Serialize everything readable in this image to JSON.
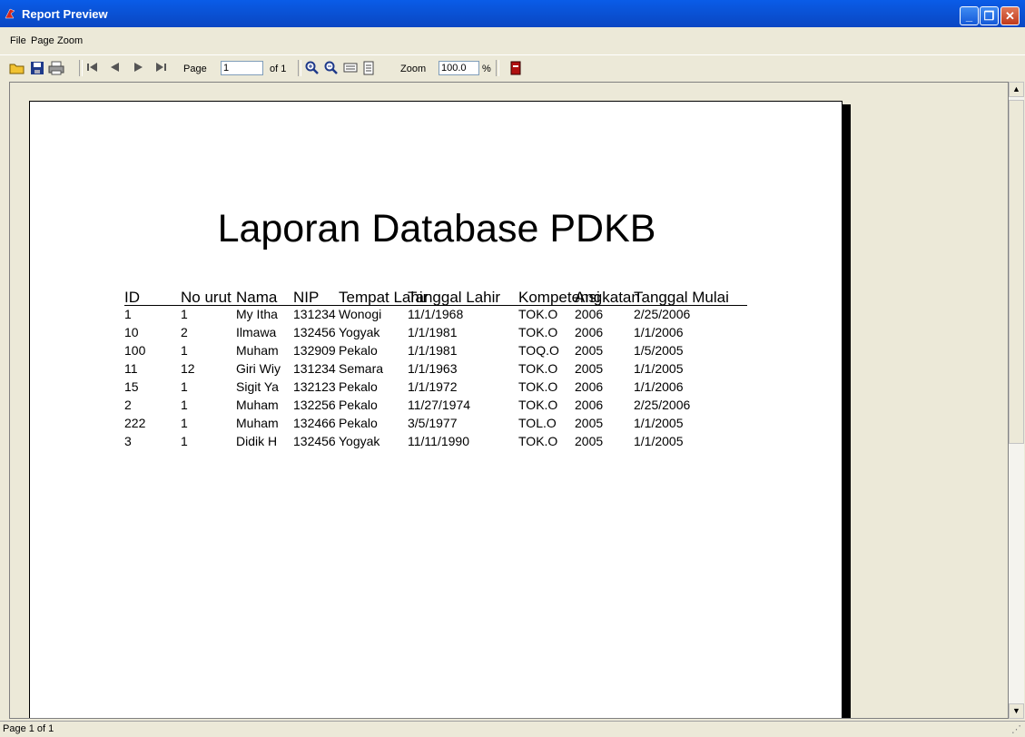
{
  "window": {
    "title": "Report Preview"
  },
  "menu": [
    "File",
    "Page",
    "Zoom"
  ],
  "toolbar": {
    "page_label": "Page",
    "page_value": "1",
    "of_label": "of 1",
    "zoom_label": "Zoom",
    "zoom_value": "100.0",
    "percent": "%"
  },
  "report": {
    "title": "Laporan Database PDKB",
    "columns": [
      "ID",
      "No urut",
      "Nama",
      "NIP",
      "Tempat Lahir",
      "Tanggal Lahir",
      "Kompetensi",
      "Angkatan",
      "Tanggal Mulai"
    ],
    "rows": [
      [
        "1",
        "1",
        "My Itha",
        "131234",
        "Wonogi",
        "11/1/1968",
        "TOK.O",
        "2006",
        "2/25/2006"
      ],
      [
        "10",
        "2",
        "Ilmawa",
        "132456",
        "Yogyak",
        "1/1/1981",
        "TOK.O",
        "2006",
        "1/1/2006"
      ],
      [
        "100",
        "1",
        "Muham",
        "132909",
        "Pekalo",
        "1/1/1981",
        "TOQ.O",
        "2005",
        "1/5/2005"
      ],
      [
        "11",
        "12",
        "Giri Wiy",
        "131234",
        "Semara",
        "1/1/1963",
        "TOK.O",
        "2005",
        "1/1/2005"
      ],
      [
        "15",
        "1",
        "Sigit Ya",
        "132123",
        "Pekalo",
        "1/1/1972",
        "TOK.O",
        "2006",
        "1/1/2006"
      ],
      [
        "2",
        "1",
        "Muham",
        "132256",
        "Pekalo",
        "11/27/1974",
        "TOK.O",
        "2006",
        "2/25/2006"
      ],
      [
        "222",
        "1",
        "Muham",
        "132466",
        "Pekalo",
        "3/5/1977",
        "TOL.O",
        "2005",
        "1/1/2005"
      ],
      [
        "3",
        "1",
        "Didik H",
        "132456",
        "Yogyak",
        "11/11/1990",
        "TOK.O",
        "2005",
        "1/1/2005"
      ]
    ]
  },
  "status": "Page 1 of 1",
  "icons": [
    "open-icon",
    "save-icon",
    "print-icon",
    "first-page-icon",
    "prev-page-icon",
    "next-page-icon",
    "last-page-icon",
    "zoom-in-icon",
    "zoom-out-icon",
    "page-width-icon",
    "whole-page-icon",
    "exit-icon"
  ]
}
